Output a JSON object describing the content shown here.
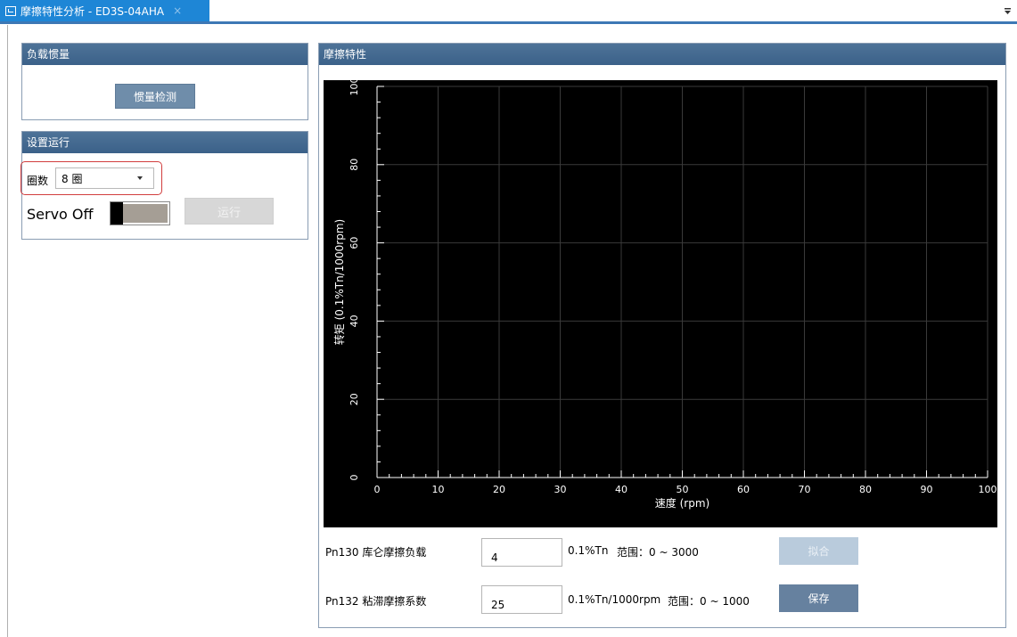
{
  "tab": {
    "title": "摩擦特性分析 - ED3S-04AHA",
    "close": "×"
  },
  "load_inertia": {
    "title": "负载惯量",
    "detect_button": "惯量检测"
  },
  "run_setup": {
    "title": "设置运行",
    "turns_label": "圈数",
    "turns_value": "8 圈",
    "servo_label": "Servo Off",
    "servo_state": "off",
    "run_button": "运行"
  },
  "friction": {
    "title": "摩擦特性",
    "params": [
      {
        "label": "Pn130 库仑摩擦负载",
        "value": "4",
        "unit": "0.1%Tn",
        "range": "范围：0 ~ 3000",
        "button": "拟合"
      },
      {
        "label": "Pn132 粘滞摩擦系数",
        "value": "25",
        "unit": "0.1%Tn/1000rpm",
        "range": "范围：0 ~ 1000",
        "button": "保存"
      }
    ]
  },
  "chart_data": {
    "type": "line",
    "title": "",
    "xlabel": "速度 (rpm)",
    "ylabel": "转矩 (0.1%Tn/1000rpm)",
    "xlim": [
      0,
      100
    ],
    "ylim": [
      0,
      100
    ],
    "xticks": [
      "0",
      "10",
      "20",
      "30",
      "40",
      "50",
      "60",
      "70",
      "80",
      "90",
      "100"
    ],
    "yticks": [
      "0",
      "20",
      "40",
      "60",
      "80",
      "100"
    ],
    "grid": true,
    "background": "#000000",
    "series": []
  },
  "colors": {
    "accent": "#1e86d6",
    "panel_header": "#46698f",
    "highlight": "#d13d3d"
  }
}
